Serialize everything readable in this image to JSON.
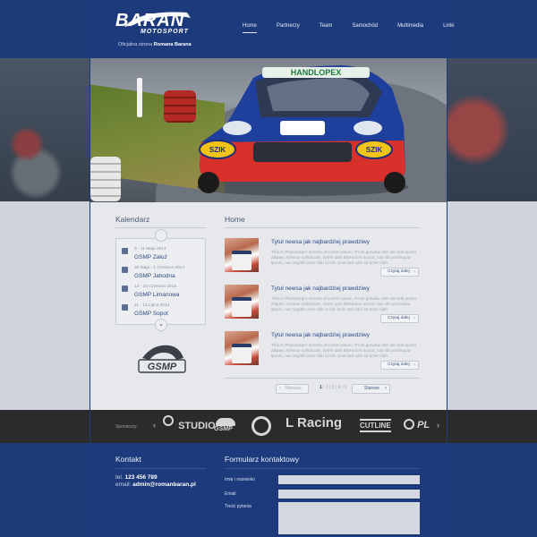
{
  "brand": {
    "name": "BARAN",
    "sub": "MOTOSPORT",
    "tagline_prefix": "Oficjalna strona",
    "tagline_name": "Romana Barana"
  },
  "nav": {
    "items": [
      {
        "label": "Home"
      },
      {
        "label": "Partnerzy"
      },
      {
        "label": "Team"
      },
      {
        "label": "Samochód"
      },
      {
        "label": "Multimedia"
      },
      {
        "label": "Linki"
      }
    ]
  },
  "hero": {
    "car_banner": "HANDLOPEX",
    "car_decal": "SZIK"
  },
  "calendar": {
    "title": "Kalendarz",
    "events": [
      {
        "date": "9 - 11 Maja 2014",
        "name": "GSMP Załuż"
      },
      {
        "date": "30 Maja - 1 Czerwca 2014",
        "name": "GSMP Jahodna"
      },
      {
        "date": "13 - 15 Czerwca 2014",
        "name": "GSMP Limanowa"
      },
      {
        "date": "11 - 13 Lipca 2014",
        "name": "GSMP Sopot"
      }
    ],
    "logo_text": "GSMP"
  },
  "home": {
    "title": "Home",
    "news": [
      {
        "title": "Tytuł newsa jak najbardziej prawdziwy",
        "text": "This is Photoshop's version  of Lorem Ipsum. Proin gravida nibh vel velit auctor aliquet. Aenean sollicitudin, lorem quis bibendum auctor, nisi elit consequat ipsum, nec sagittis sem nibh id elit. Duis sed odio sit amet nibh",
        "button": "Czytaj dalej"
      },
      {
        "title": "Tytuł newsa jak najbardziej prawdziwy",
        "text": "This is Photoshop's version  of Lorem Ipsum. Proin gravida nibh vel velit auctor aliquet. Aenean sollicitudin, lorem quis bibendum auctor, nisi elit consequat ipsum, nec sagittis sem nibh id elit. Duis sed odio sit amet nibh",
        "button": "Czytaj dalej"
      },
      {
        "title": "Tytuł newsa jak najbardziej prawdziwy",
        "text": "This is Photoshop's version  of Lorem Ipsum. Proin gravida nibh vel velit auctor aliquet. Aenean sollicitudin, lorem quis bibendum auctor, nisi elit consequat ipsum, nec sagittis sem nibh id elit. Duis sed odio sit amet nibh",
        "button": "Czytaj dalej"
      }
    ],
    "pager": {
      "prev": "Newsze",
      "next": "Starsze",
      "pages": [
        "1",
        "2",
        "3",
        "4",
        "5"
      ],
      "current": "1"
    }
  },
  "sponsors": {
    "label": "Sponsorzy",
    "items": [
      "STUDIO",
      "GSMP",
      "L Racing",
      "CUTLINE",
      "PL"
    ]
  },
  "contact": {
    "title": "Kontakt",
    "tel_label": "tel.",
    "tel": "123 456 789",
    "email_label": "email:",
    "email": "admin@romanbaran.pl"
  },
  "form": {
    "title": "Formularz kontaktowy",
    "name_label": "Imię i nazwisko",
    "email_label": "Email",
    "question_label": "Treść pytania"
  },
  "colors": {
    "primary": "#1d3b7c",
    "content_bg": "#e6e8ec",
    "sponsor_bar": "#2b2b2b",
    "link": "#2c4a8a"
  }
}
